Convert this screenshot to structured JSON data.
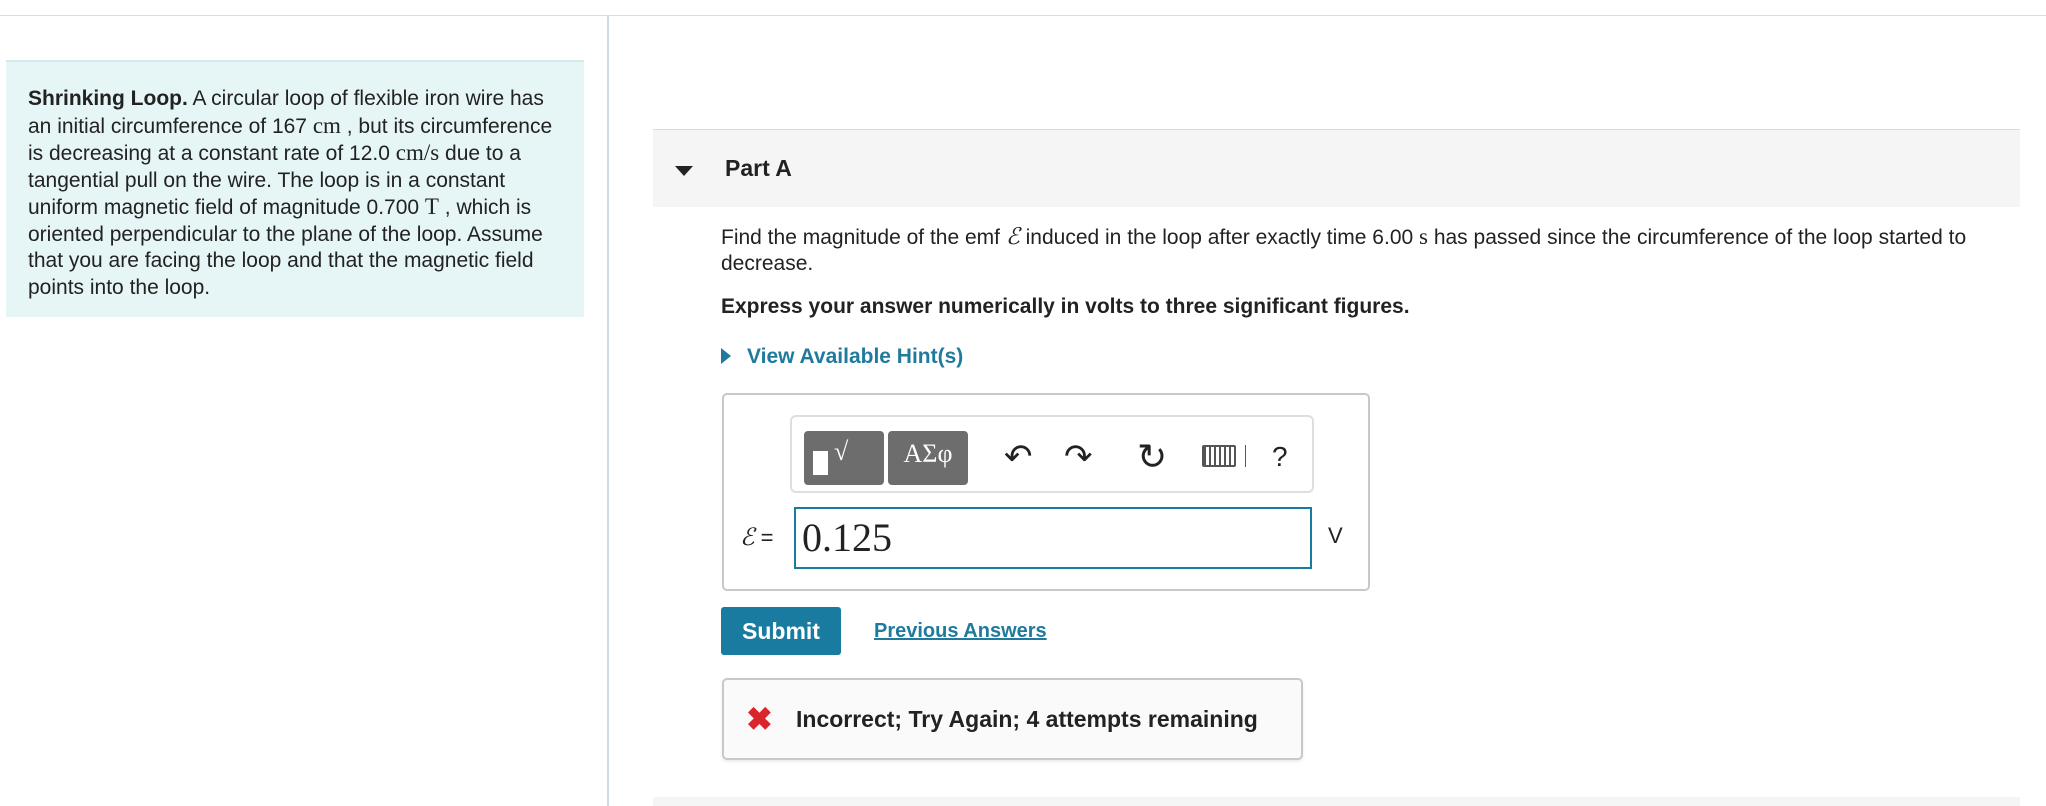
{
  "problem": {
    "title": "Shrinking Loop.",
    "text_1": " A circular loop of flexible iron wire has an initial circumference of 167 ",
    "unit_cm": "cm",
    "text_2": " , but its circumference is decreasing at a constant rate of 12.0 ",
    "unit_rate": "cm/s",
    "text_3": " due to a tangential pull on the wire. The loop is in a constant uniform magnetic field of magnitude 0.700 ",
    "unit_T": "T",
    "text_4": " , which is oriented perpendicular to the plane of the loop. Assume that you are facing the loop and that the magnetic field points into the loop."
  },
  "part": {
    "title": "Part A",
    "question_1": "Find the magnitude of the emf ",
    "emf_symbol": "ℰ",
    "question_2": " induced in the loop after exactly time 6.00 ",
    "unit_s": "s",
    "question_3": " has passed since the circumference of the loop started to decrease.",
    "instruction": "Express your answer numerically in volts to three significant figures.",
    "hint_link": "View Available Hint(s)"
  },
  "toolbar": {
    "templates_label": "√",
    "symbols_label": "ΑΣφ",
    "undo_icon": "↶",
    "redo_icon": "↷",
    "reset_icon": "↻",
    "help_label": "?"
  },
  "answer": {
    "label": "ℰ",
    "equals": " =",
    "value": "0.125",
    "unit": "V"
  },
  "actions": {
    "submit": "Submit",
    "previous_answers": "Previous Answers"
  },
  "feedback": {
    "icon": "✖",
    "message": "Incorrect; Try Again; 4 attempts remaining",
    "color": "#d9262c"
  }
}
